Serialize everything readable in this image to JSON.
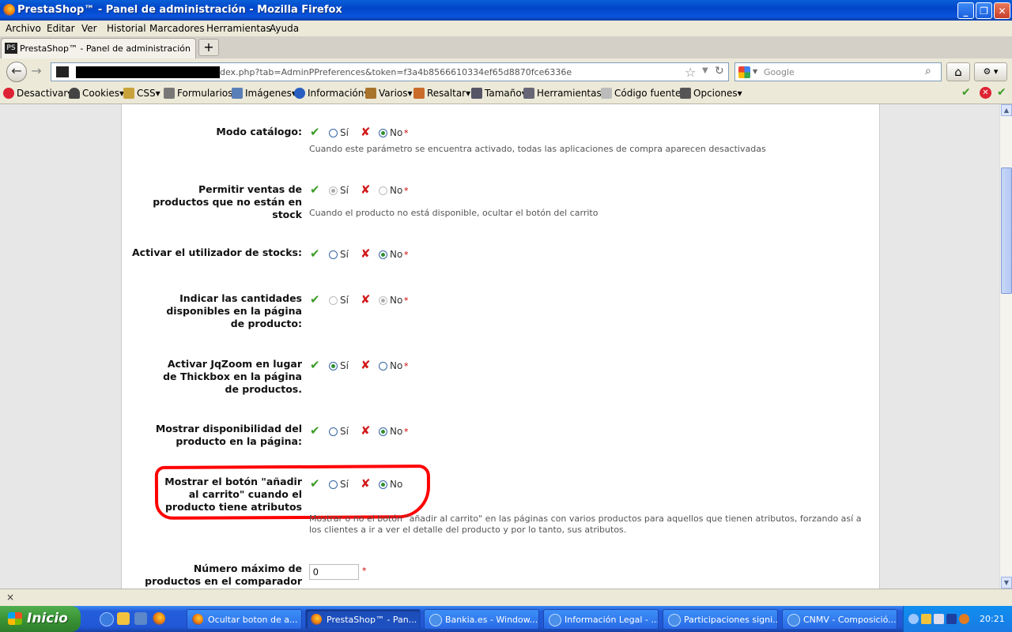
{
  "window": {
    "title": "PrestaShop™ - Panel de administración - Mozilla Firefox",
    "min_icon": "minimize-icon",
    "max_icon": "restore-icon",
    "close_icon": "close-icon"
  },
  "menu": [
    "Archivo",
    "Editar",
    "Ver",
    "Historial",
    "Marcadores",
    "Herramientas",
    "Ayuda"
  ],
  "tab": {
    "label": "PrestaShop™ - Panel de administración",
    "newtab_label": "+"
  },
  "nav": {
    "url_visible": "dex.php?tab=AdminPPreferences&token=f3a4b8566610334ef65d8870fce6336e",
    "search_placeholder": "Google"
  },
  "devbar": [
    "Desactivar",
    "Cookies",
    "CSS",
    "Formularios",
    "Imágenes",
    "Información",
    "Varios",
    "Resaltar",
    "Tamaño",
    "Herramientas",
    "Código fuente",
    "Opciones"
  ],
  "form": {
    "yes_label": "Sí",
    "no_label": "No",
    "required_mark": "*",
    "rows": [
      {
        "label": "Modo catálogo:",
        "hint": "Cuando este parámetro se encuentra activado, todas las aplicaciones de compra aparecen desactivadas",
        "selected": "no",
        "disabled": false,
        "required": true
      },
      {
        "label": "Permitir ventas de productos que no están en stock",
        "hint": "Cuando el producto no está disponible, ocultar el botón del carrito",
        "selected": "yes",
        "disabled": true,
        "required": true
      },
      {
        "label": "Activar el utilizador de stocks:",
        "hint": "",
        "selected": "no",
        "disabled": false,
        "required": true
      },
      {
        "label": "Indicar las cantidades disponibles en la página de producto:",
        "hint": "",
        "selected": "no",
        "disabled": true,
        "required": true
      },
      {
        "label": "Activar JqZoom en lugar de Thickbox en la página de productos.",
        "hint": "",
        "selected": "yes",
        "disabled": false,
        "required": true
      },
      {
        "label": "Mostrar disponibilidad del producto en la página:",
        "hint": "",
        "selected": "no",
        "disabled": false,
        "required": true
      },
      {
        "label": "Mostrar el botón \"añadir al carrito\" cuando el producto tiene atributos",
        "hint": "Mostrar o no el botón \"añadir al carrito\" en las páginas con varios productos para aquellos que tienen atributos, forzando así a los clientes a ir a ver el detalle del producto y por lo tanto, sus atributos.",
        "selected": "no",
        "disabled": false,
        "required": false
      }
    ],
    "compare": {
      "label": "Número máximo de productos en el comparador",
      "value": "0"
    }
  },
  "findbar": {
    "close": "×"
  },
  "taskbar": {
    "start": "Inicio",
    "buttons": [
      "Ocultar boton de a...",
      "PrestaShop™ - Pan...",
      "Bankia.es - Window...",
      "Información Legal - ...",
      "Participaciones signi...",
      "CNMV - Composició..."
    ],
    "clock": "20:21"
  }
}
